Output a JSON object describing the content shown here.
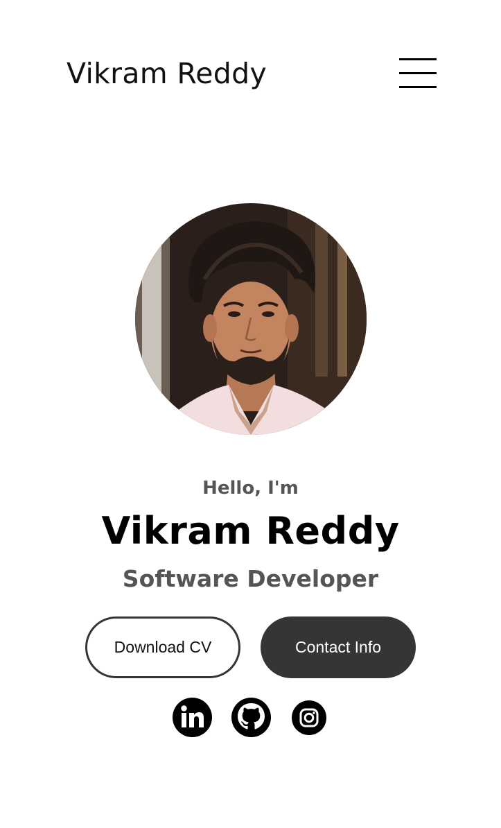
{
  "header": {
    "site_title": "Vikram Reddy",
    "menu_icon": "hamburger-menu-icon"
  },
  "profile": {
    "image": "profile-photo",
    "greeting": "Hello, I'm",
    "name": "Vikram Reddy",
    "role": "Software Developer"
  },
  "buttons": {
    "download_cv": "Download CV",
    "contact_info": "Contact Info"
  },
  "socials": [
    {
      "icon": "linkedin-icon"
    },
    {
      "icon": "github-icon"
    },
    {
      "icon": "instagram-icon"
    }
  ],
  "colors": {
    "dark": "#353535",
    "muted_text": "#555555",
    "background": "#ffffff"
  }
}
